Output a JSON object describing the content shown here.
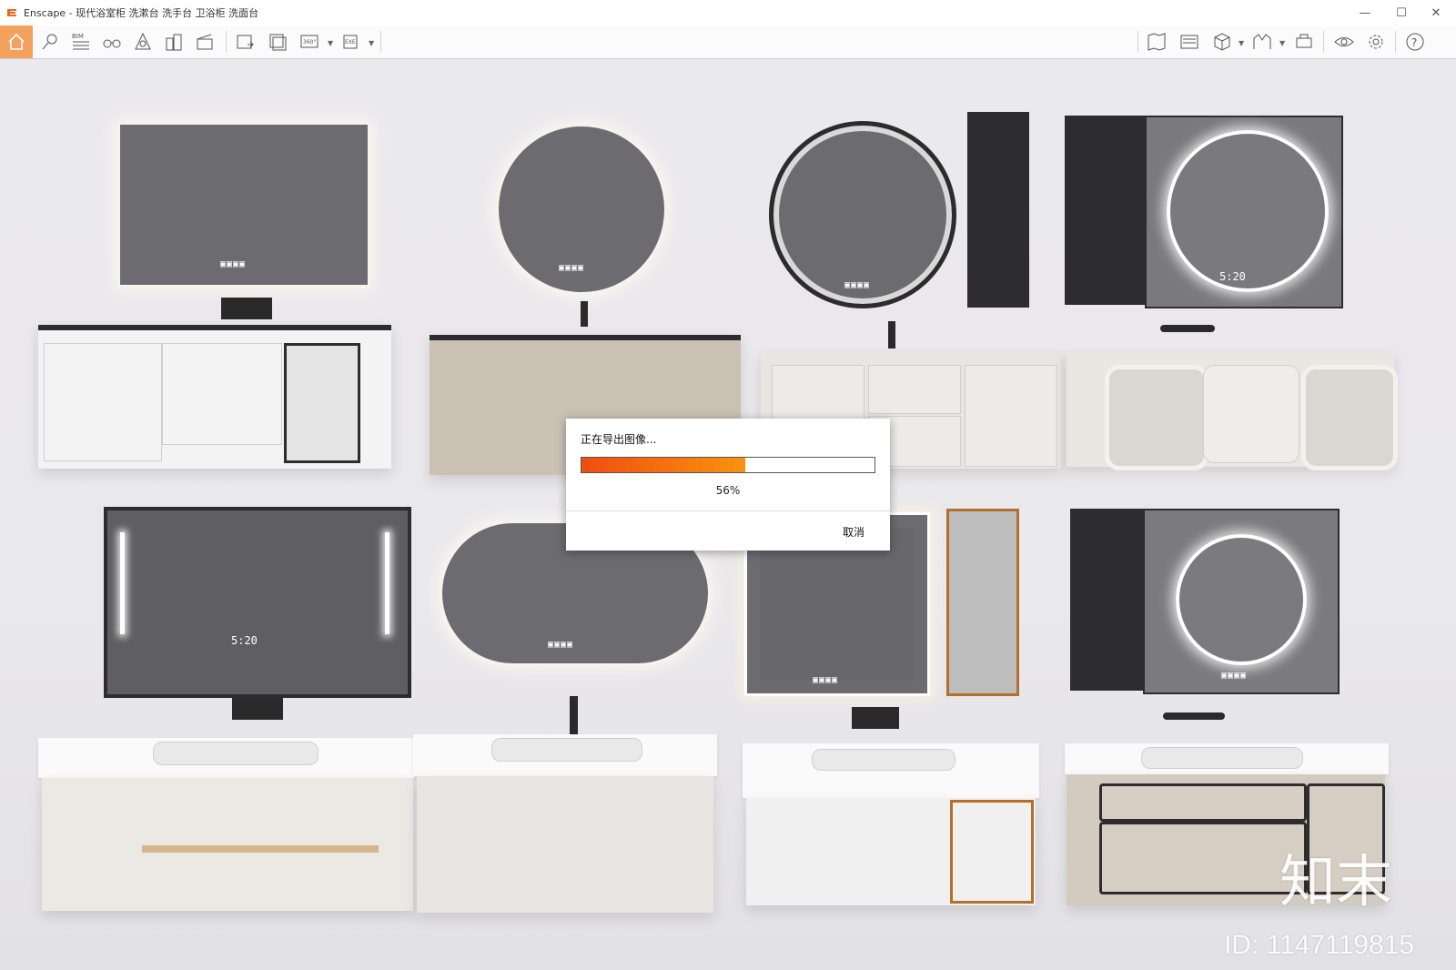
{
  "window": {
    "title": "Enscape - 现代浴室柜 洗漱台 洗手台 卫浴柜 洗面台",
    "minimize": "—",
    "maximize": "☐",
    "close": "✕"
  },
  "toolbar": {
    "left_icons": [
      "home-icon",
      "map-pin-icon",
      "bim-icon",
      "binoculars-icon",
      "compass-icon",
      "buildings-icon",
      "clapboard-icon",
      "screenshot-icon",
      "batch-render-icon",
      "panorama-360-icon",
      "export-exe-icon"
    ],
    "bim_label": "BIM",
    "pano_label": "360°",
    "exe_label": "EXE",
    "right_icons": [
      "map-icon",
      "panel-icon",
      "cube-view-icon",
      "atmosphere-icon",
      "asset-library-icon",
      "visibility-icon",
      "settings-icon",
      "help-icon"
    ],
    "help_label": "?",
    "accent_color": "#f5a15e"
  },
  "scene": {
    "clock_text": "5:20",
    "mirror_icons": "▣▣▣▣"
  },
  "watermark": {
    "logo_text": "知末",
    "id_text": "ID: 1147119815"
  },
  "dialog": {
    "title": "正在导出图像...",
    "progress_fraction": 0.56,
    "percent_text": "56%",
    "cancel_label": "取消",
    "progress_colors": [
      "#f04e0f",
      "#f8930f"
    ]
  }
}
